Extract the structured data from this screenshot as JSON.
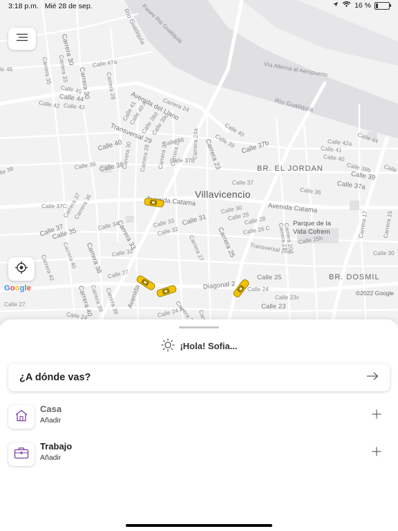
{
  "status_bar": {
    "time": "3:18 p.m.",
    "date": "Mié 28 de sep.",
    "battery_text": "16 %",
    "battery_level": 0.16
  },
  "map": {
    "copyright": "©2022 Google",
    "google_logo": {
      "g": "G",
      "o1": "o",
      "o2": "o",
      "g2": "g",
      "l": "l",
      "e": "e"
    },
    "labels": {
      "city": "Villavicencio",
      "br_jordan": "BR. EL JORDAN",
      "br_dosmil": "BR. DOSMIL",
      "parque_1": "Parque de la",
      "parque_2": "Vida Cofrem",
      "rio_guatiquia_a": "Río Guatiquía",
      "rio_guatiquia_b": "Río Guatiquía",
      "via_alterna": "Vía Alterna al Aeropuerto",
      "paseo": "Paseo Rio Guatiquia",
      "calle46": "Calle 46",
      "carrera30a": "Carrera 30",
      "carrera33": "Carrera 33",
      "carrera35": "Carrera 35",
      "calle47a": "Calle 47a",
      "carrera28": "Carrera 28",
      "carrera30b": "Carrera 30",
      "calle45": "Calle 45",
      "calle44a": "Calle 44",
      "calle42a": "Calle 42",
      "calle43": "Calle 43",
      "av_llano": "Avenida del Llano",
      "carrera24a": "Carrera 24",
      "calle41": "Calle 41",
      "calle40a_small": "Calle 40 A",
      "calle39d": "Calle 39d",
      "calle39c": "Calle 39c",
      "transversal29": "Transversal 29",
      "calle40b": "Calle 40",
      "calle39a": "Calle 39",
      "carrera23": "Carrera 23",
      "calle38a": "Calle 38",
      "calle37b": "Calle 37b",
      "calle40c": "Calle 40",
      "calle39b": "Calle 39",
      "calle38b": "Calle 38",
      "carrera30c": "Carrera 30",
      "carrera28b": "Carrera 28",
      "carrera27": "Carrera 27",
      "carrera26": "Carrera 26",
      "calle37b2": "Calle 37b",
      "carrera24a2": "Carrera 24a",
      "calle37a": "Calle 37",
      "calle36a": "Calle 36",
      "calle37a2": "Calle 37a",
      "calle39_e": "Calle 39",
      "calle39b2": "Calle 39b",
      "calle40_e": "Calle 40",
      "calle41_e": "Calle 41",
      "calle42a2": "Calle 42a",
      "calle44_e": "Calle 44",
      "calle4": "Calle 4",
      "av_catama": "Avenida Catama",
      "av_catama2": "Avenida Catama",
      "calle37c": "Calle 37C",
      "carrera37": "Carrera 37",
      "carrera36": "Carrera 36",
      "calle37_w": "Calle 37",
      "calle35": "Calle 35",
      "calle34": "Calle 34",
      "carrera33b": "Carrera 33",
      "calle33": "Calle 33",
      "calle32": "Calle 32",
      "calle31": "Calle 31",
      "calle30": "Calle 30",
      "calle29": "Calle 29",
      "calle28": "Calle 28",
      "carrera25": "Carrera 25",
      "carrera27b": "Carrera 27",
      "calle26c": "Calle 26 C",
      "carrera20d": "Carrera 20d",
      "carrera21": "Carrera 21",
      "calle25h": "Calle 25h",
      "transversal26c": "Transversal 26c",
      "carrera17": "Carrera 17",
      "carrera15": "Carrera 15",
      "calle30_e": "Calle 30",
      "carrera40": "Carrera 40",
      "carrera42": "Carrera 42",
      "carrera38": "Carrera 38",
      "calle27": "Calle 27",
      "calle27b": "Calle 27",
      "carrera40b": "Carrera 40",
      "carrera39": "Carrera 39",
      "carrera38b": "Carrera 38",
      "avenida_s": "Avenida",
      "diagonal": "Diagonal 2",
      "calle24": "Calle 24",
      "calle25": "Calle 25",
      "calle23c": "Calle 23c",
      "calle23": "Calle 23",
      "calle24_w": "Calle 24",
      "calle24a": "Calle 24 A",
      "carrera34": "Carrera 34",
      "carre": "Carre",
      "calle_w36": "lle 38",
      "calle_46w": "le 46",
      "calle_left": "lle 38"
    }
  },
  "sheet": {
    "greeting": "¡Hola! Sofia...",
    "search_label": "¿A dónde vas?",
    "places": [
      {
        "title": "Casa",
        "subtitle": "Añadir"
      },
      {
        "title": "Trabajo",
        "subtitle": "Añadir"
      }
    ]
  },
  "colors": {
    "accent": "#7b3fa0",
    "taxi": "#f2c200"
  }
}
